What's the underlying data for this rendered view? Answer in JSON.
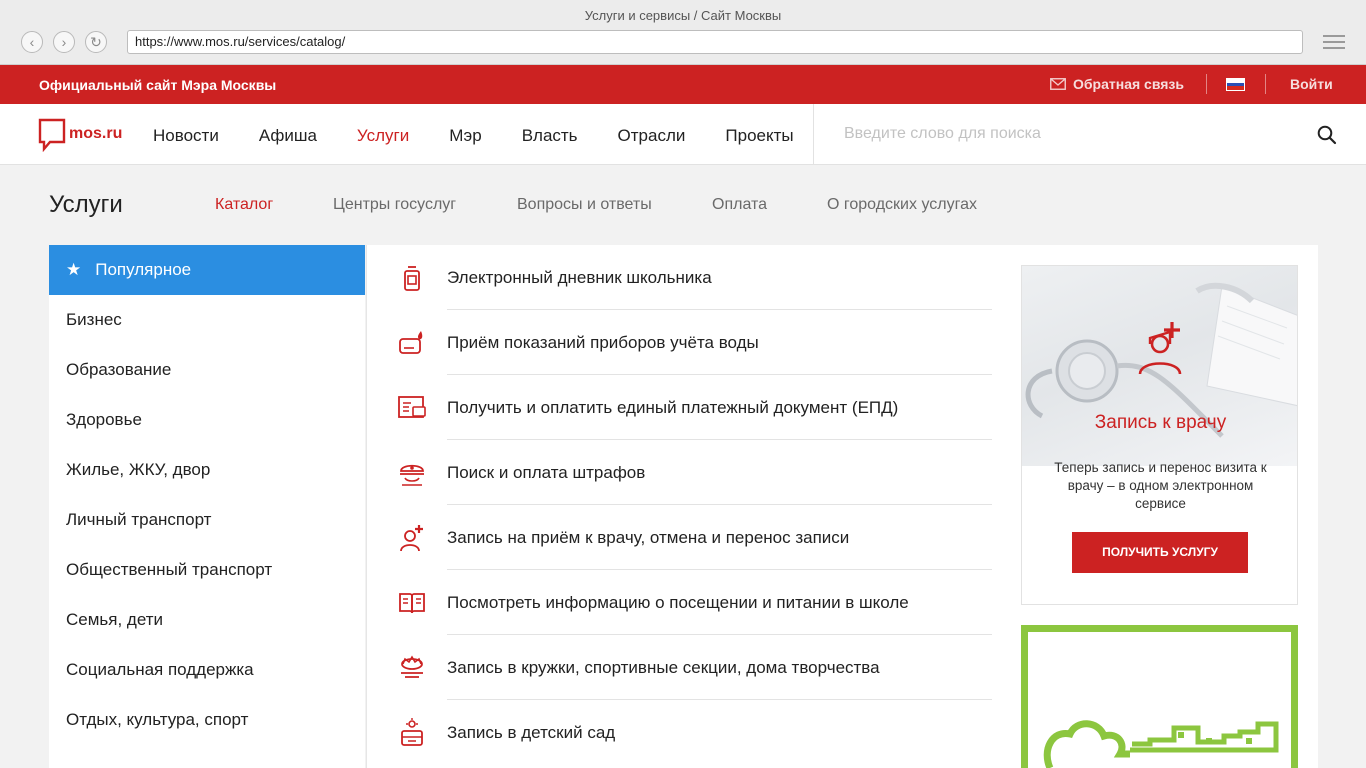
{
  "browser": {
    "title": "Услуги и сервисы / Сайт Москвы",
    "url": "https://www.mos.ru/services/catalog/"
  },
  "topbar": {
    "site_title": "Официальный сайт Мэра Москвы",
    "feedback": "Обратная связь",
    "login": "Войти"
  },
  "header": {
    "logo": "mos.ru",
    "nav": [
      "Новости",
      "Афиша",
      "Услуги",
      "Мэр",
      "Власть",
      "Отрасли",
      "Проекты"
    ],
    "active_nav": "Услуги",
    "search_placeholder": "Введите слово для поиска"
  },
  "section": {
    "title": "Услуги",
    "tabs": [
      "Каталог",
      "Центры госуслуг",
      "Вопросы и ответы",
      "Оплата",
      "О городских услугах"
    ]
  },
  "sidebar": {
    "items": [
      "Популярное",
      "Бизнес",
      "Образование",
      "Здоровье",
      "Жилье, ЖКУ, двор",
      "Личный транспорт",
      "Общественный транспорт",
      "Семья, дети",
      "Социальная поддержка",
      "Отдых, культура, спорт"
    ]
  },
  "services": [
    {
      "label": "Электронный дневник школьника",
      "icon": "school-diary-icon"
    },
    {
      "label": "Приём показаний приборов учёта воды",
      "icon": "water-meter-icon"
    },
    {
      "label": "Получить и оплатить единый платежный документ (ЕПД)",
      "icon": "payment-document-icon"
    },
    {
      "label": "Поиск и оплата штрафов",
      "icon": "police-cap-icon"
    },
    {
      "label": "Запись на приём к врачу, отмена и перенос записи",
      "icon": "doctor-icon"
    },
    {
      "label": "Посмотреть информацию о посещении и питании в школе",
      "icon": "book-icon"
    },
    {
      "label": "Запись в кружки, спортивные секции, дома творчества",
      "icon": "activities-icon"
    },
    {
      "label": "Запись в детский сад",
      "icon": "kindergarten-icon"
    }
  ],
  "promo": {
    "title": "Запись к врачу",
    "text": "Теперь запись и перенос визита к врачу – в одном электронном сервисе",
    "button": "ПОЛУЧИТЬ УСЛУГУ"
  },
  "colors": {
    "brand_red": "#cc2222",
    "active_blue": "#2b8ee1",
    "promo_green": "#8cc63f"
  }
}
